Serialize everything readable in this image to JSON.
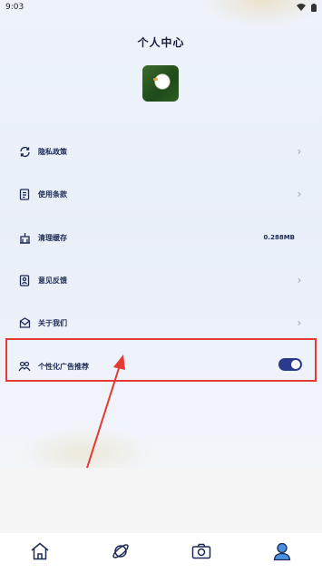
{
  "status_bar": {
    "time": "9:03"
  },
  "header": {
    "title": "个人中心"
  },
  "menu": {
    "items": [
      {
        "label": "隐私政策",
        "icon": "sync-icon"
      },
      {
        "label": "使用条款",
        "icon": "document-icon"
      },
      {
        "label": "清理缓存",
        "icon": "clean-icon",
        "value": "0.288MB"
      },
      {
        "label": "意见反馈",
        "icon": "feedback-icon"
      },
      {
        "label": "关于我们",
        "icon": "mail-icon"
      }
    ],
    "ad_recommend": {
      "label": "个性化广告推荐",
      "icon": "people-icon",
      "enabled": true
    }
  },
  "tabs": [
    {
      "name": "home-icon"
    },
    {
      "name": "planet-icon"
    },
    {
      "name": "camera-icon"
    },
    {
      "name": "user-icon",
      "active": true
    }
  ],
  "colors": {
    "accent": "#2a3a8c",
    "highlight": "#e53935",
    "text": "#1c2a55"
  }
}
